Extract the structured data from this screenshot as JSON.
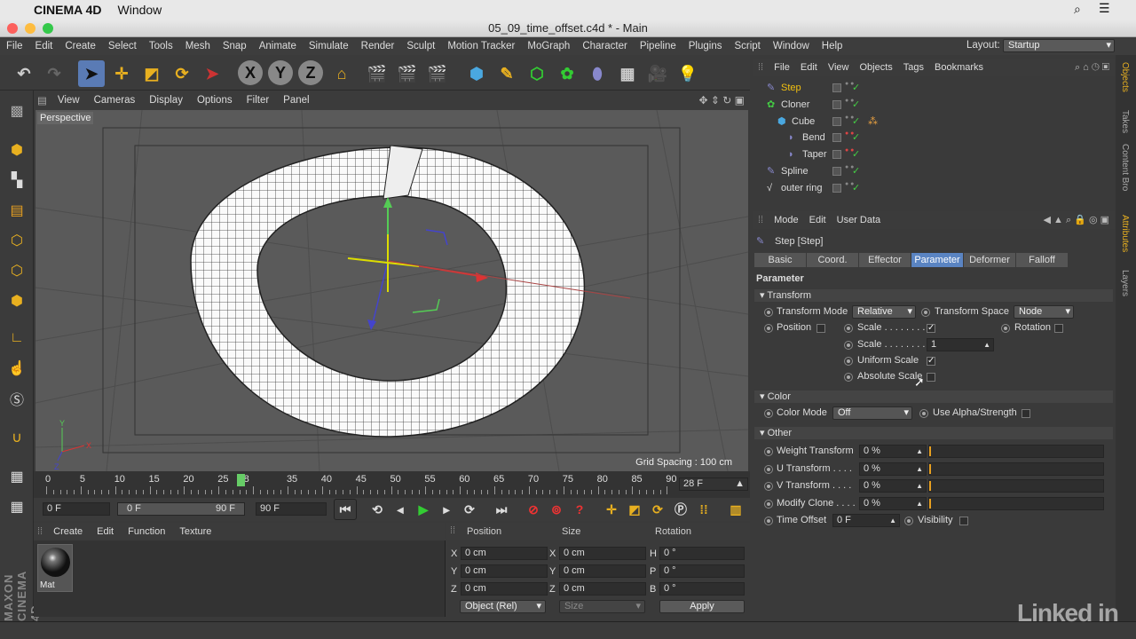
{
  "mac": {
    "app": "CINEMA 4D",
    "menu": "Window"
  },
  "window": {
    "title": "05_09_time_offset.c4d * - Main"
  },
  "menubar": [
    "File",
    "Edit",
    "Create",
    "Select",
    "Tools",
    "Mesh",
    "Snap",
    "Animate",
    "Simulate",
    "Render",
    "Sculpt",
    "Motion Tracker",
    "MoGraph",
    "Character",
    "Pipeline",
    "Plugins",
    "Script",
    "Window",
    "Help"
  ],
  "layout": {
    "label": "Layout:",
    "value": "Startup"
  },
  "viewport": {
    "menu": [
      "View",
      "Cameras",
      "Display",
      "Options",
      "Filter",
      "Panel"
    ],
    "name": "Perspective",
    "grid_spacing": "Grid Spacing : 100 cm"
  },
  "timeline": {
    "ticks": [
      "0",
      "5",
      "10",
      "15",
      "20",
      "25",
      "28",
      "35",
      "40",
      "45",
      "50",
      "55",
      "60",
      "65",
      "70",
      "75",
      "80",
      "85",
      "90"
    ],
    "current": "28 F",
    "current_frame": 28
  },
  "transport": {
    "start": "0 F",
    "range_start": "0 F",
    "range_end": "90 F",
    "end": "90 F"
  },
  "material": {
    "menu": [
      "Create",
      "Edit",
      "Function",
      "Texture"
    ],
    "name": "Mat"
  },
  "coords": {
    "headers": [
      "Position",
      "Size",
      "Rotation"
    ],
    "rows": [
      {
        "axis": "X",
        "pos": "0 cm",
        "saxis": "X",
        "size": "0 cm",
        "raxis": "H",
        "rot": "0 °"
      },
      {
        "axis": "Y",
        "pos": "0 cm",
        "saxis": "Y",
        "size": "0 cm",
        "raxis": "P",
        "rot": "0 °"
      },
      {
        "axis": "Z",
        "pos": "0 cm",
        "saxis": "Z",
        "size": "0 cm",
        "raxis": "B",
        "rot": "0 °"
      }
    ],
    "mode": "Object (Rel)",
    "size_mode": "Size",
    "apply": "Apply"
  },
  "objects": {
    "menu": [
      "File",
      "Edit",
      "View",
      "Objects",
      "Tags",
      "Bookmarks"
    ],
    "items": [
      {
        "name": "Step",
        "color": "#f2c010"
      },
      {
        "name": "Cloner",
        "color": "#ddd"
      },
      {
        "name": "Cube",
        "color": "#ddd"
      },
      {
        "name": "Bend",
        "color": "#ddd"
      },
      {
        "name": "Taper",
        "color": "#ddd"
      },
      {
        "name": "Spline",
        "color": "#ddd"
      },
      {
        "name": "outer ring",
        "color": "#ddd"
      }
    ]
  },
  "attributes": {
    "menu": [
      "Mode",
      "Edit",
      "User Data"
    ],
    "object": "Step [Step]",
    "tabs": [
      "Basic",
      "Coord.",
      "Effector",
      "Parameter",
      "Deformer",
      "Falloff"
    ],
    "active_tab": "Parameter",
    "heading": "Parameter",
    "transform": {
      "section": "Transform",
      "mode_label": "Transform Mode",
      "mode": "Relative",
      "space_label": "Transform Space",
      "space": "Node",
      "position": "Position",
      "scale": "Scale . . . . . . . .",
      "scale_value_label": "Scale . . . . . . . .",
      "scale_value": "1",
      "rotation": "Rotation",
      "uniform": "Uniform Scale",
      "absolute": "Absolute Scale"
    },
    "color": {
      "section": "Color",
      "mode_label": "Color Mode",
      "mode": "Off",
      "alpha": "Use Alpha/Strength"
    },
    "other": {
      "section": "Other",
      "weight": "Weight Transform",
      "weight_v": "0 %",
      "u": "U Transform . . . .",
      "u_v": "0 %",
      "v": "V Transform . . . .",
      "v_v": "0 %",
      "modify": "Modify Clone . . . .",
      "modify_v": "0 %",
      "time": "Time Offset",
      "time_v": "0 F",
      "visibility": "Visibility"
    }
  },
  "right_tabs": [
    "Objects",
    "Takes",
    "Content Bro",
    "Attributes",
    "Layers"
  ],
  "watermark": "Linked in",
  "brand": "MAXON CINEMA 4D"
}
